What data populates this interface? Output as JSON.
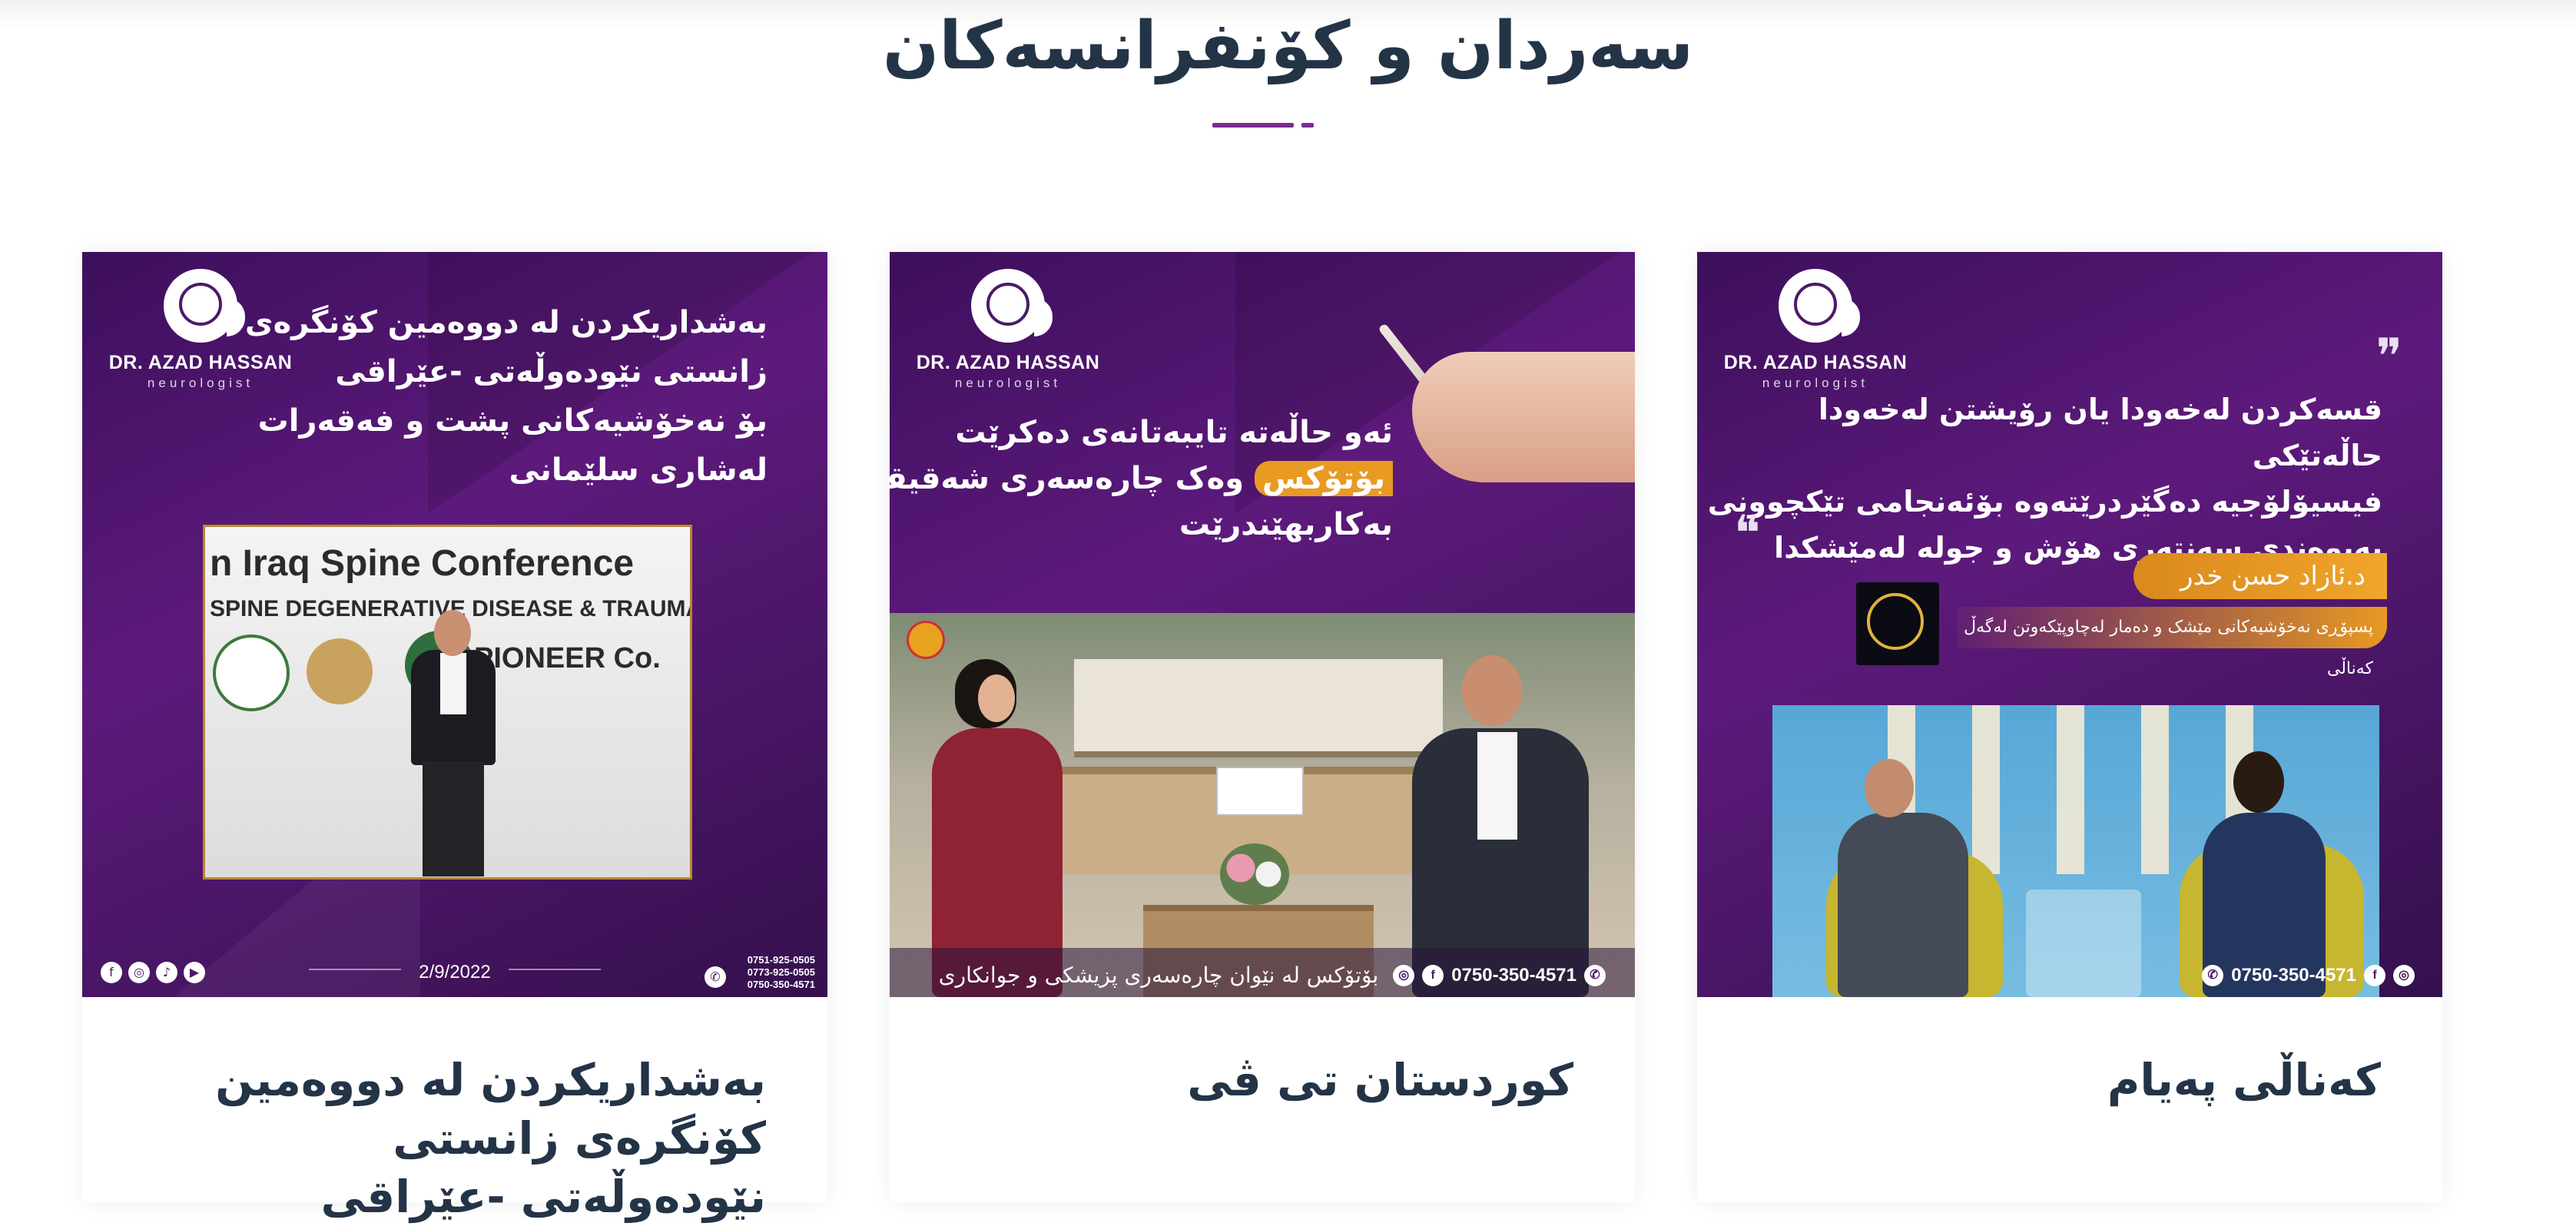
{
  "section": {
    "title": "سەردان و کۆنفرانسەکان"
  },
  "cards": [
    {
      "title": "بەشداریکردن لە دووەمین کۆنگرەی زانستی نێودەوڵەتی -عێراقی",
      "logo": {
        "name": "DR. AZAD HASSAN",
        "sub": "neurologist"
      },
      "poster_lines": [
        "بەشداریکردن لە دووەمین کۆنگرەی",
        "زانستی نێودەوڵەتی -عێراقی",
        "بۆ نەخۆشیەکانی پشت و فەقەرات",
        "لەشاری سلێمانی"
      ],
      "photo": {
        "banner_line1": "n Iraq Spine Conference",
        "banner_line2": "SPINE DEGENERATIVE DISEASE & TRAUMA",
        "banner_line3": "PIONEER Co."
      },
      "date": "2/9/2022",
      "phones": [
        "0751-925-0505",
        "0773-925-0505",
        "0750-350-4571"
      ],
      "social_icons": [
        "facebook-icon",
        "instagram-icon",
        "tiktok-icon",
        "youtube-icon"
      ]
    },
    {
      "title": "کوردستان تی ڤی",
      "logo": {
        "name": "DR. AZAD HASSAN",
        "sub": "neurologist"
      },
      "poster_lines": [
        "ئەو حاڵەتە تایبەتانەی دەکرێت",
        "وەک چارەسەری شەقیقە",
        "بەکاربهێندرێت"
      ],
      "poster_highlight": "بۆتۆکس",
      "photo_caption": "بۆتۆکس لە نێوان چارەسەری پزیشکی و جوانکاری",
      "phone": "0750-350-4571"
    },
    {
      "title": "کەناڵی پەیام",
      "logo": {
        "name": "DR. AZAD HASSAN",
        "sub": "neurologist"
      },
      "quote_lines": [
        "قسەکردن لەخەودا یان رۆیشتن لەخەودا حاڵەتێکی",
        "فیسیۆلۆجیە دەگێردرێتەوە بۆئەنجامی تێکچوونی",
        "پەیوەندی سەنتەری هۆش و جولە لەمێشکدا"
      ],
      "guest_name": "د.ئازاد حسن خدر",
      "guest_role": "پسپۆڕی نەخۆشیەکانی مێشک و دەمار لەچاوپێکەوتن لەگەڵ کەناڵی",
      "phone": "0750-350-4571"
    }
  ]
}
